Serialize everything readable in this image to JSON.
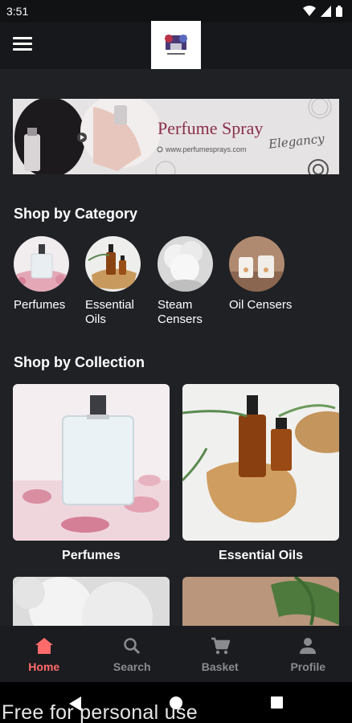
{
  "status_bar": {
    "time": "3:51"
  },
  "banner": {
    "title": "Perfume Spray",
    "script": "Elegancy",
    "url": "www.perfumesprays.com"
  },
  "sections": {
    "category_title": "Shop by Category",
    "collection_title": "Shop by Collection"
  },
  "categories": [
    {
      "label": "Perfumes"
    },
    {
      "label": "Essential Oils"
    },
    {
      "label": "Steam Censers"
    },
    {
      "label": "Oil Censers"
    }
  ],
  "collections": [
    {
      "label": "Perfumes"
    },
    {
      "label": "Essential Oils"
    }
  ],
  "bottom_nav": {
    "items": [
      {
        "label": "Home",
        "icon": "home-icon",
        "active": true
      },
      {
        "label": "Search",
        "icon": "search-icon",
        "active": false
      },
      {
        "label": "Basket",
        "icon": "cart-icon",
        "active": false
      },
      {
        "label": "Profile",
        "icon": "person-icon",
        "active": false
      }
    ]
  },
  "watermark": "Free for personal use",
  "colors": {
    "background": "#1f2125",
    "accent": "#ff6b6b",
    "inactive": "#8a8b8f"
  }
}
